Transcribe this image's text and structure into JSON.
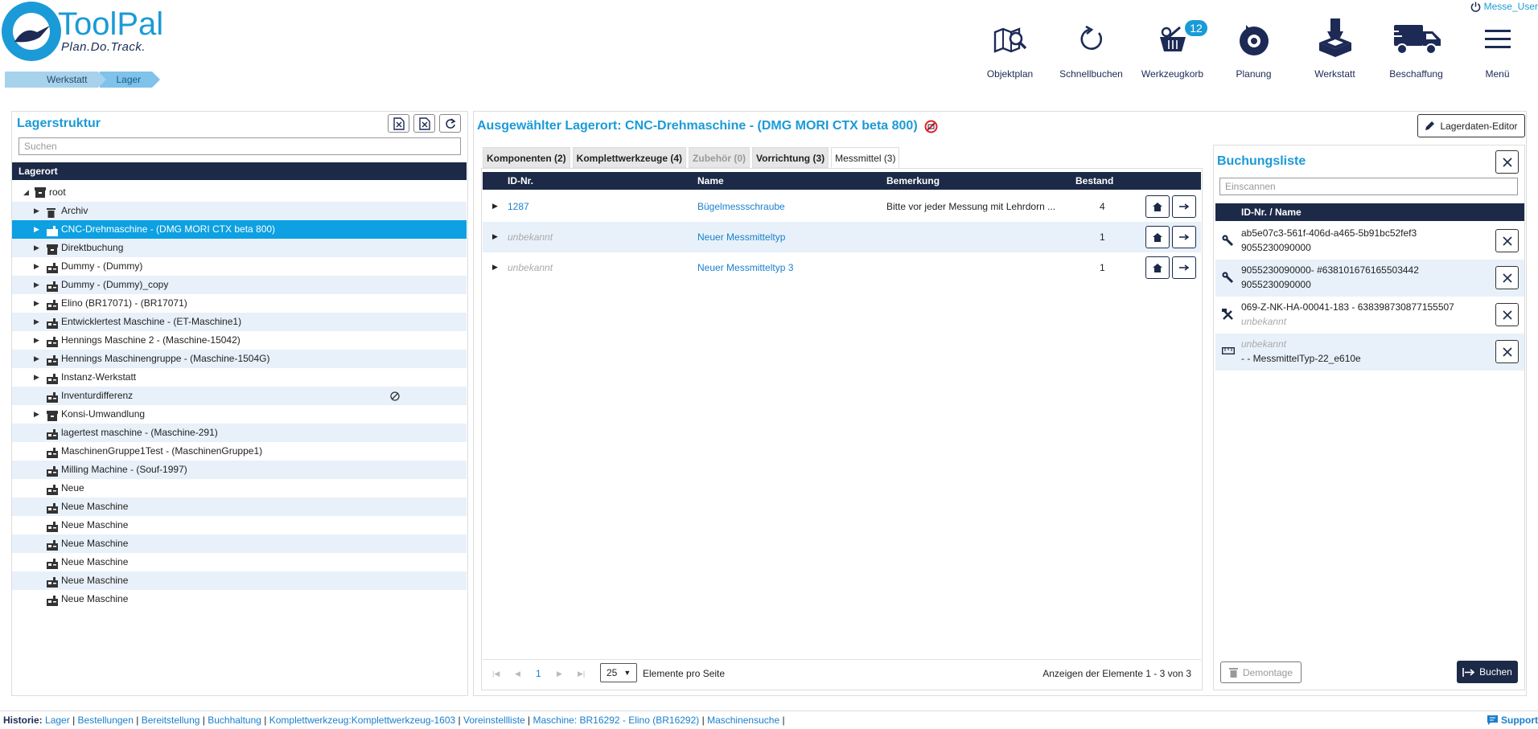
{
  "app": {
    "logo_text": "ToolPal",
    "logo_sub": "Plan.Do.Track.",
    "user": "Messe_User"
  },
  "breadcrumb": [
    "Werkstatt",
    "Lager"
  ],
  "nav": [
    {
      "label": "Objektplan",
      "icon": "map-search-icon"
    },
    {
      "label": "Schnellbuchen",
      "icon": "refresh-icon"
    },
    {
      "label": "Werkzeugkorb",
      "icon": "basket-icon",
      "badge": "12"
    },
    {
      "label": "Planung",
      "icon": "planning-icon"
    },
    {
      "label": "Werkstatt",
      "icon": "workshop-icon"
    },
    {
      "label": "Beschaffung",
      "icon": "truck-icon"
    },
    {
      "label": "Menü",
      "icon": "hamburger-icon"
    }
  ],
  "left": {
    "title": "Lagerstruktur",
    "search_placeholder": "Suchen",
    "col": "Lagerort",
    "root": "root",
    "rows": [
      {
        "label": "Archiv",
        "icon": "trash",
        "expand": true
      },
      {
        "label": "CNC-Drehmaschine - (DMG MORI CTX beta 800)",
        "icon": "machine",
        "expand": true,
        "selected": true
      },
      {
        "label": "Direktbuchung",
        "icon": "box",
        "expand": true
      },
      {
        "label": "Dummy - (Dummy)",
        "icon": "machine",
        "expand": true
      },
      {
        "label": "Dummy - (Dummy)_copy",
        "icon": "machine",
        "expand": true
      },
      {
        "label": "Elino (BR17071) - (BR17071)",
        "icon": "machine",
        "expand": true
      },
      {
        "label": "Entwicklertest Maschine - (ET-Maschine1)",
        "icon": "machine",
        "expand": true
      },
      {
        "label": "Hennings Maschine 2 - (Maschine-15042)",
        "icon": "machine",
        "expand": true
      },
      {
        "label": "Hennings Maschinengruppe - (Maschine-1504G)",
        "icon": "machine",
        "expand": true
      },
      {
        "label": "Instanz-Werkstatt",
        "icon": "machine",
        "expand": true
      },
      {
        "label": "Inventurdifferenz",
        "icon": "machine",
        "expand": false,
        "blocked": true
      },
      {
        "label": "Konsi-Umwandlung",
        "icon": "box",
        "expand": true
      },
      {
        "label": "lagertest maschine - (Maschine-291)",
        "icon": "machine",
        "expand": false
      },
      {
        "label": "MaschinenGruppe1Test - (MaschinenGruppe1)",
        "icon": "machine",
        "expand": false
      },
      {
        "label": "Milling Machine - (Souf-1997)",
        "icon": "machine",
        "expand": false
      },
      {
        "label": "Neue",
        "icon": "machine",
        "expand": false
      },
      {
        "label": "Neue Maschine",
        "icon": "machine",
        "expand": false
      },
      {
        "label": "Neue Maschine",
        "icon": "machine",
        "expand": false
      },
      {
        "label": "Neue Maschine",
        "icon": "machine",
        "expand": false
      },
      {
        "label": "Neue Maschine",
        "icon": "machine",
        "expand": false
      },
      {
        "label": "Neue Maschine",
        "icon": "machine",
        "expand": false
      },
      {
        "label": "Neue Maschine",
        "icon": "machine",
        "expand": false
      }
    ]
  },
  "main": {
    "title": "Ausgewählter Lagerort: CNC-Drehmaschine - (DMG MORI CTX beta 800)",
    "editor_btn": "Lagerdaten-Editor",
    "tabs": [
      {
        "label": "Komponenten (2)",
        "state": "normal"
      },
      {
        "label": "Komplettwerkzeuge (4)",
        "state": "normal"
      },
      {
        "label": "Zubehör (0)",
        "state": "disabled"
      },
      {
        "label": "Vorrichtung (3)",
        "state": "normal"
      },
      {
        "label": "Messmittel (3)",
        "state": "active"
      }
    ],
    "cols": [
      "ID-Nr.",
      "Name",
      "Bemerkung",
      "Bestand"
    ],
    "rows": [
      {
        "id": "1287",
        "id_unknown": false,
        "name": "Bügelmessschraube",
        "note": "Bitte vor jeder Messung mit Lehrdorn ...",
        "stock": "4"
      },
      {
        "id": "unbekannt",
        "id_unknown": true,
        "name": "Neuer Messmitteltyp",
        "note": "",
        "stock": "1"
      },
      {
        "id": "unbekannt",
        "id_unknown": true,
        "name": "Neuer Messmitteltyp 3",
        "note": "",
        "stock": "1"
      }
    ],
    "pager": {
      "page": "1",
      "size": "25",
      "per_page": "Elemente pro Seite",
      "info": "Anzeigen der Elemente 1 - 3 von 3"
    }
  },
  "booking": {
    "title": "Buchungsliste",
    "scan_placeholder": "Einscannen",
    "col": "ID-Nr. / Name",
    "items": [
      {
        "icon": "wrench",
        "l1": "ab5e07c3-561f-406d-a465-5b91bc52fef3",
        "l1_muted": false,
        "l2": "9055230090000",
        "l2_muted": false
      },
      {
        "icon": "wrench",
        "l1": "9055230090000- #638101676165503442",
        "l1_muted": false,
        "l2": "9055230090000",
        "l2_muted": false
      },
      {
        "icon": "tools",
        "l1": "069-Z-NK-HA-00041-183 - 638398730877155507",
        "l1_muted": false,
        "l2": "unbekannt",
        "l2_muted": true
      },
      {
        "icon": "ruler",
        "l1": "unbekannt",
        "l1_muted": true,
        "l2": "- - MessmittelTyp-22_e610e",
        "l2_muted": false
      }
    ],
    "demontage": "Demontage",
    "buchen": "Buchen"
  },
  "footer": {
    "label": "Historie:",
    "links": [
      "Lager",
      "Bestellungen",
      "Bereitstellung",
      "Buchhaltung",
      "Komplettwerkzeug:Komplettwerkzeug-1603",
      "Voreinstellliste",
      "Maschine: BR16292 - Elino (BR16292)",
      "Maschinensuche"
    ],
    "support": "Support"
  },
  "colors": {
    "accent": "#1a9bd7",
    "dark": "#1c2a48",
    "selected": "#0da0e2",
    "alt_row": "#e8f1fa"
  }
}
